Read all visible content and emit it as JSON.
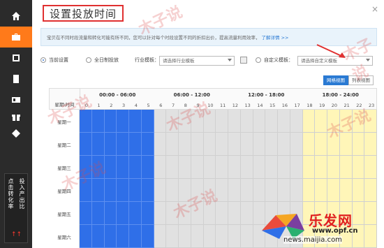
{
  "colors": {
    "sidebar_bg": "#2b2b2b",
    "accent": "#ff7a1a",
    "selected_blue": "#2f6fe8",
    "gray_block": "#e1e1e1",
    "yellow_block": "#fff6b8"
  },
  "sidebar": {
    "items": [
      {
        "icon": "home-icon"
      },
      {
        "icon": "briefcase-icon",
        "active": true
      },
      {
        "icon": "square-icon"
      },
      {
        "icon": "document-icon"
      },
      {
        "icon": "id-card-icon"
      },
      {
        "icon": "gift-icon"
      },
      {
        "icon": "diamond-icon"
      }
    ],
    "note_col1": "点击转化率",
    "note_col2": "投入产出比",
    "note_arrows": "↑↑"
  },
  "header": {
    "title": "设置投放时间",
    "close_label": "×"
  },
  "notice": {
    "text": "宝贝在不同时段流量和转化可能有所不同，您可以针对每个时段设置不同的折扣出价，提高流量利用效率，",
    "link": "了解详情 >>"
  },
  "options": {
    "current_setting": "当前设置",
    "full_day": "全日制投放",
    "industry_template": "行业模板：",
    "industry_placeholder": "请选择行业模板",
    "custom_template": "自定义模板：",
    "custom_placeholder": "请选择自定义模板"
  },
  "view_toggle": {
    "grid_view": "网格视图",
    "list_view": "列表视图"
  },
  "schedule": {
    "row_header": "星期\\时间",
    "blocks": [
      "00:00 - 06:00",
      "06:00 - 12:00",
      "12:00 - 18:00",
      "18:00 - 24:00"
    ],
    "hours": [
      "0",
      "1",
      "2",
      "3",
      "4",
      "5",
      "6",
      "7",
      "8",
      "9",
      "10",
      "11",
      "12",
      "13",
      "14",
      "15",
      "16",
      "17",
      "18",
      "19",
      "20",
      "21",
      "22",
      "23"
    ],
    "days": [
      "星期一",
      "星期二",
      "星期三",
      "星期四",
      "星期五",
      "星期六"
    ],
    "hour_state": [
      "sel",
      "sel",
      "sel",
      "sel",
      "sel",
      "sel",
      "gray",
      "gray",
      "gray",
      "gray",
      "gray",
      "gray",
      "gray",
      "gray",
      "gray",
      "gray",
      "gray",
      "gray",
      "yellow",
      "yellow",
      "yellow",
      "yellow",
      "yellow",
      "yellow"
    ]
  },
  "watermark": "木子说",
  "logo": {
    "brand": "乐发网",
    "url": "www.opf.cn",
    "url2": "news.maijia.com"
  }
}
